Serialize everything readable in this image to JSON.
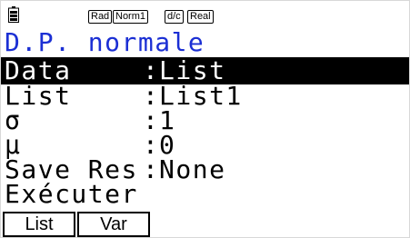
{
  "status": {
    "angle": "Rad",
    "display": "Norm1",
    "fraction": "d/c",
    "complex": "Real",
    "icon": "battery-icon"
  },
  "title": "D.P. normale",
  "rows": [
    {
      "label": "Data",
      "value": "List",
      "selected": true
    },
    {
      "label": "List",
      "value": "List1",
      "selected": false
    },
    {
      "label": "σ",
      "value": "1",
      "selected": false
    },
    {
      "label": "μ",
      "value": "0",
      "selected": false
    },
    {
      "label": "Save Res",
      "value": "None",
      "selected": false
    }
  ],
  "separator": ":",
  "execute": "Exécuter",
  "fkeys": [
    "List",
    "Var"
  ]
}
